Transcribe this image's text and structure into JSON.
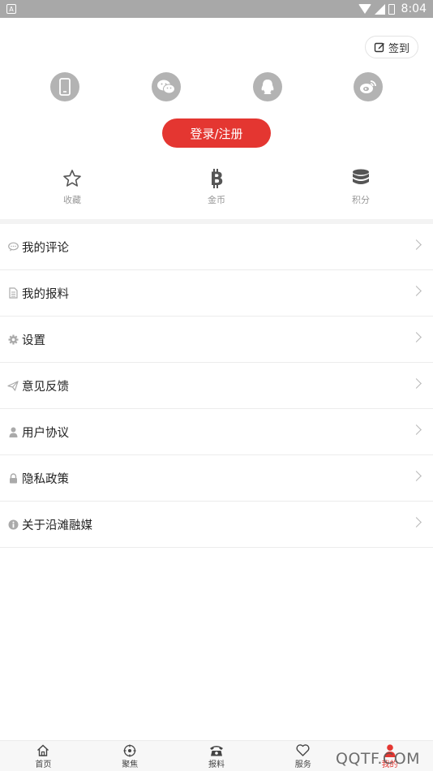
{
  "status_bar": {
    "time": "8:04",
    "notification_icon": "A",
    "battery_icon": "battery-icon"
  },
  "header": {
    "signin_label": "签到"
  },
  "social_login": [
    {
      "name": "phone",
      "icon": "phone-icon"
    },
    {
      "name": "wechat",
      "icon": "wechat-icon"
    },
    {
      "name": "qq",
      "icon": "qq-icon"
    },
    {
      "name": "weibo",
      "icon": "weibo-icon"
    }
  ],
  "login_button": {
    "label": "登录/注册",
    "color": "#e43631"
  },
  "stats": [
    {
      "label": "收藏",
      "icon": "star-icon"
    },
    {
      "label": "金币",
      "icon": "bitcoin-icon"
    },
    {
      "label": "积分",
      "icon": "database-icon"
    }
  ],
  "menu": [
    {
      "label": "我的评论",
      "icon": "comment-icon"
    },
    {
      "label": "我的报料",
      "icon": "document-icon"
    },
    {
      "label": "设置",
      "icon": "gear-icon"
    },
    {
      "label": "意见反馈",
      "icon": "paper-plane-icon"
    },
    {
      "label": "用户协议",
      "icon": "user-icon"
    },
    {
      "label": "隐私政策",
      "icon": "lock-icon"
    },
    {
      "label": "关于沿滩融媒",
      "icon": "info-icon"
    }
  ],
  "tabbar": [
    {
      "label": "首页",
      "icon": "home-icon",
      "active": false
    },
    {
      "label": "聚焦",
      "icon": "focus-icon",
      "active": false
    },
    {
      "label": "报料",
      "icon": "telephone-icon",
      "active": false
    },
    {
      "label": "服务",
      "icon": "heart-icon",
      "active": false
    },
    {
      "label": "我的",
      "icon": "user-icon",
      "active": true
    }
  ],
  "watermark": "QQTF.COM",
  "colors": {
    "accent": "#e43631",
    "status_bar": "#a8a8a8",
    "icon_gray": "#b3b3b3"
  }
}
